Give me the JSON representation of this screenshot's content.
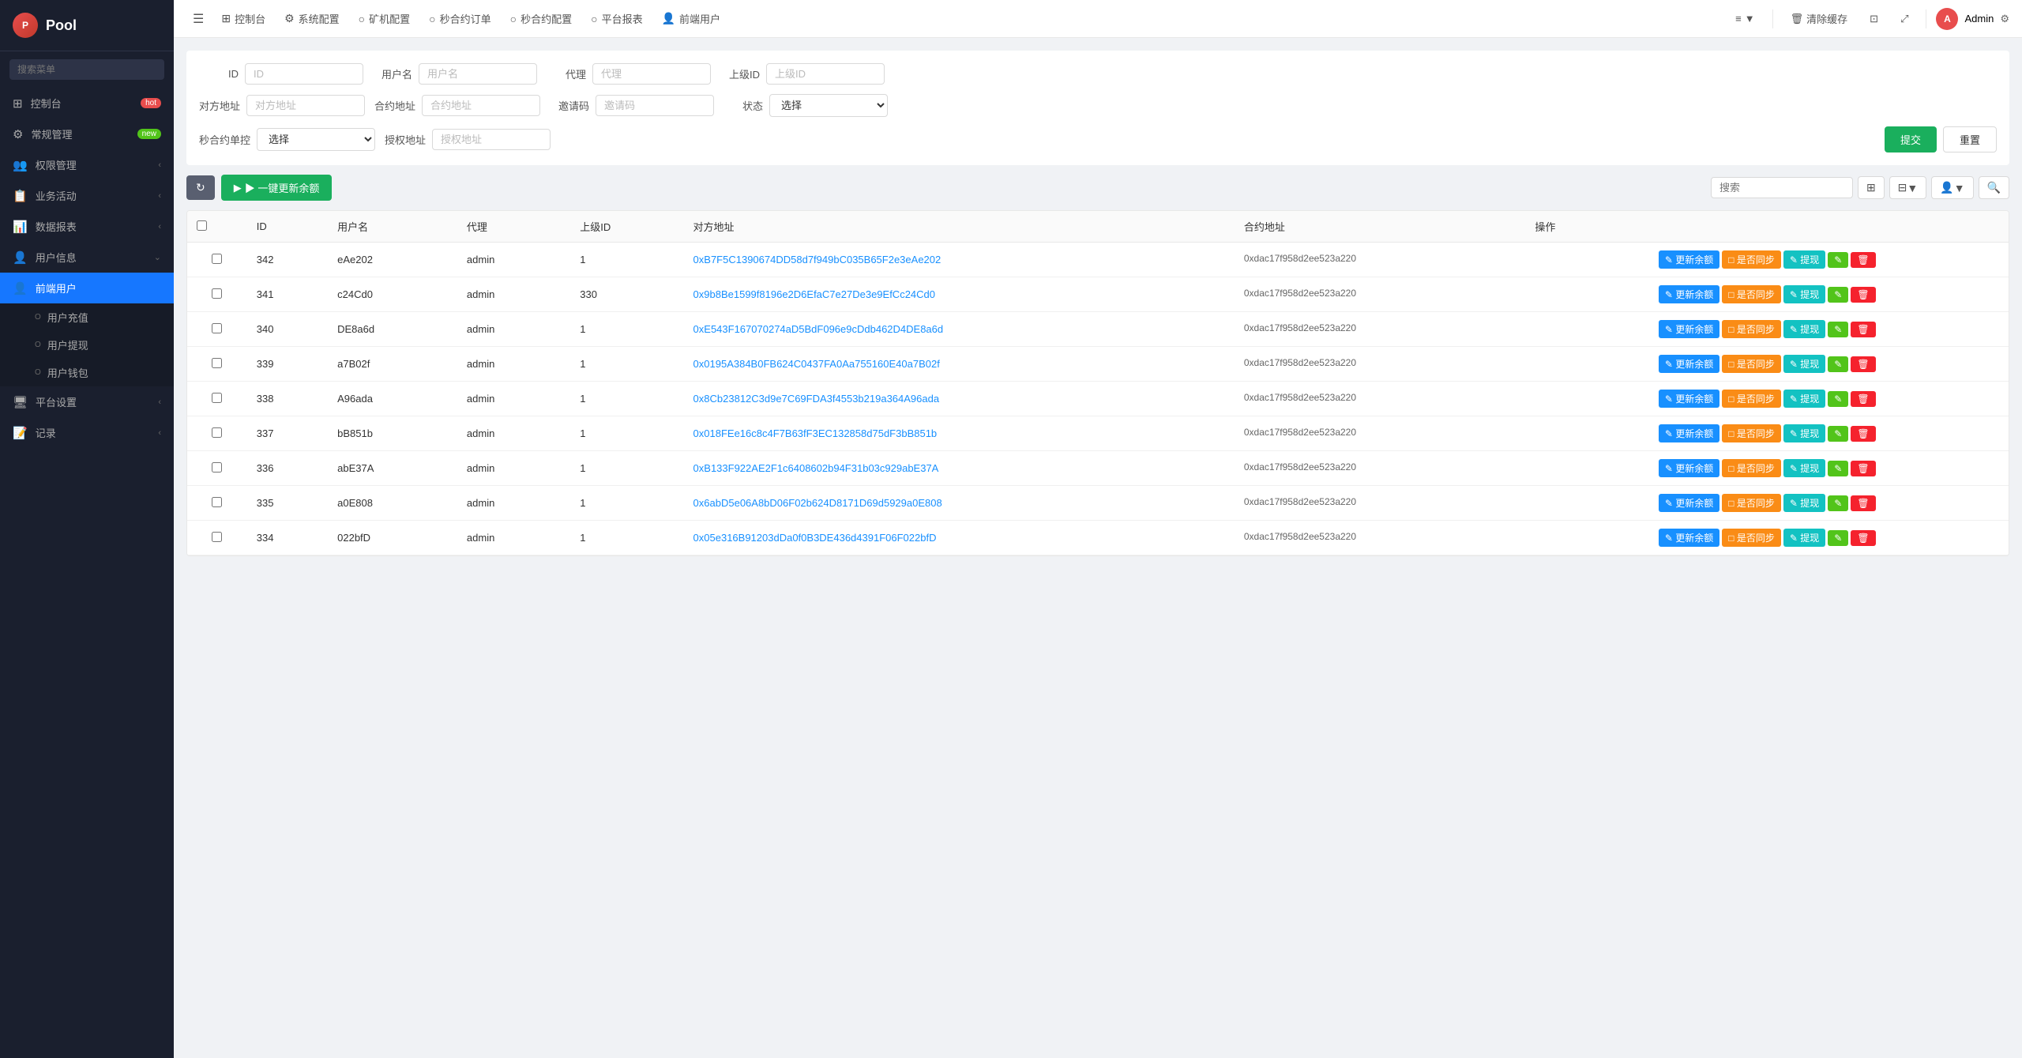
{
  "sidebar": {
    "logo": "Pool",
    "logo_abbr": "P",
    "search_placeholder": "搜索菜单",
    "nav_items": [
      {
        "id": "dashboard",
        "label": "控制台",
        "icon": "⊞",
        "badge": "hot",
        "badge_type": "hot"
      },
      {
        "id": "general",
        "label": "常规管理",
        "icon": "⚙",
        "badge": "new",
        "badge_type": "new"
      },
      {
        "id": "permissions",
        "label": "权限管理",
        "icon": "👥",
        "arrow": true
      },
      {
        "id": "business",
        "label": "业务活动",
        "icon": "📋",
        "arrow": true
      },
      {
        "id": "reports",
        "label": "数据报表",
        "icon": "📊",
        "arrow": true
      },
      {
        "id": "userinfo",
        "label": "用户信息",
        "icon": "👤",
        "arrow": true
      },
      {
        "id": "frontend-user",
        "label": "前端用户",
        "icon": "👤",
        "active": true
      },
      {
        "id": "user-recharge",
        "label": "用户充值",
        "sub": true
      },
      {
        "id": "user-withdraw",
        "label": "用户提现",
        "sub": true
      },
      {
        "id": "user-wallet",
        "label": "用户钱包",
        "sub": true
      },
      {
        "id": "platform",
        "label": "平台设置",
        "icon": "🖥",
        "arrow": true
      },
      {
        "id": "records",
        "label": "记录",
        "icon": "📝",
        "arrow": true
      }
    ]
  },
  "topbar": {
    "menu_icon": "☰",
    "nav_items": [
      {
        "id": "dashboard",
        "icon": "⊞",
        "label": "控制台"
      },
      {
        "id": "sys-config",
        "icon": "⚙",
        "label": "系统配置"
      },
      {
        "id": "miner-config",
        "icon": "○",
        "label": "矿机配置"
      },
      {
        "id": "contract-orders",
        "icon": "○",
        "label": "秒合约订单"
      },
      {
        "id": "contract-config",
        "icon": "○",
        "label": "秒合约配置"
      },
      {
        "id": "platform-report",
        "icon": "○",
        "label": "平台报表"
      },
      {
        "id": "frontend-user",
        "icon": "👤",
        "label": "前端用户"
      }
    ],
    "extra_items": [
      {
        "id": "more",
        "label": "≡▼"
      },
      {
        "id": "clear-cache",
        "label": "🗑 清除缓存"
      },
      {
        "id": "icon1",
        "label": "⊡"
      },
      {
        "id": "fullscreen",
        "label": "⤢"
      }
    ],
    "admin_label": "Admin",
    "settings_icon": "⚙"
  },
  "filters": {
    "id_label": "ID",
    "id_placeholder": "ID",
    "username_label": "用户名",
    "username_placeholder": "用户名",
    "agent_label": "代理",
    "agent_placeholder": "代理",
    "parent_id_label": "上级ID",
    "parent_id_placeholder": "上级ID",
    "counterparty_label": "对方地址",
    "counterparty_placeholder": "对方地址",
    "contract_label": "合约地址",
    "contract_placeholder": "合约地址",
    "invite_label": "邀请码",
    "invite_placeholder": "邀请码",
    "status_label": "状态",
    "status_placeholder": "选择",
    "contract_single_label": "秒合约单控",
    "contract_single_placeholder": "选择",
    "auth_label": "授权地址",
    "auth_placeholder": "授权地址",
    "submit_btn": "提交",
    "reset_btn": "重置"
  },
  "toolbar": {
    "refresh_icon": "↻",
    "update_all_btn": "▶ 一键更新余额",
    "search_placeholder": "搜索",
    "grid_icon": "⊞",
    "columns_icon": "⊟▼",
    "user_icon": "👤▼",
    "search_icon": "🔍"
  },
  "table": {
    "columns": [
      "ID",
      "用户名",
      "代理",
      "上级ID",
      "对方地址",
      "合约地址",
      "操作"
    ],
    "rows": [
      {
        "id": "342",
        "username": "eAe202",
        "agent": "admin",
        "parent_id": "1",
        "address": "0xB7F5C1390674DD58d7f949bC035B65F2e3eAe202",
        "contract": "0xdac17f958d2ee523a220"
      },
      {
        "id": "341",
        "username": "c24Cd0",
        "agent": "admin",
        "parent_id": "330",
        "address": "0x9b8Be1599f8196e2D6EfaC7e27De3e9EfCc24Cd0",
        "contract": "0xdac17f958d2ee523a220"
      },
      {
        "id": "340",
        "username": "DE8a6d",
        "agent": "admin",
        "parent_id": "1",
        "address": "0xE543F167070274aD5BdF096e9cDdb462D4DE8a6d",
        "contract": "0xdac17f958d2ee523a220"
      },
      {
        "id": "339",
        "username": "a7B02f",
        "agent": "admin",
        "parent_id": "1",
        "address": "0x0195A384B0FB624C0437FA0Aa755160E40a7B02f",
        "contract": "0xdac17f958d2ee523a220"
      },
      {
        "id": "338",
        "username": "A96ada",
        "agent": "admin",
        "parent_id": "1",
        "address": "0x8Cb23812C3d9e7C69FDA3f4553b219a364A96ada",
        "contract": "0xdac17f958d2ee523a220"
      },
      {
        "id": "337",
        "username": "bB851b",
        "agent": "admin",
        "parent_id": "1",
        "address": "0x018FEe16c8c4F7B63fF3EC132858d75dF3bB851b",
        "contract": "0xdac17f958d2ee523a220"
      },
      {
        "id": "336",
        "username": "abE37A",
        "agent": "admin",
        "parent_id": "1",
        "address": "0xB133F922AE2F1c6408602b94F31b03c929abE37A",
        "contract": "0xdac17f958d2ee523a220"
      },
      {
        "id": "335",
        "username": "a0E808",
        "agent": "admin",
        "parent_id": "1",
        "address": "0x6abD5e06A8bD06F02b624D8171D69d5929a0E808",
        "contract": "0xdac17f958d2ee523a220"
      },
      {
        "id": "334",
        "username": "022bfD",
        "agent": "admin",
        "parent_id": "1",
        "address": "0x05e316B91203dDa0f0B3DE436d4391F06F022bfD",
        "contract": "0xdac17f958d2ee523a220"
      }
    ],
    "action_labels": {
      "update_balance": "更新余额",
      "sync": "是否同步",
      "withdraw": "提现",
      "edit_icon": "✎",
      "delete_icon": "🗑"
    }
  },
  "colors": {
    "primary": "#1890ff",
    "success": "#1aaf5d",
    "warning": "#fa8c16",
    "danger": "#f5222d",
    "cyan": "#13c2c2",
    "sidebar_bg": "#1a1f2e",
    "active_bg": "#1677ff"
  }
}
